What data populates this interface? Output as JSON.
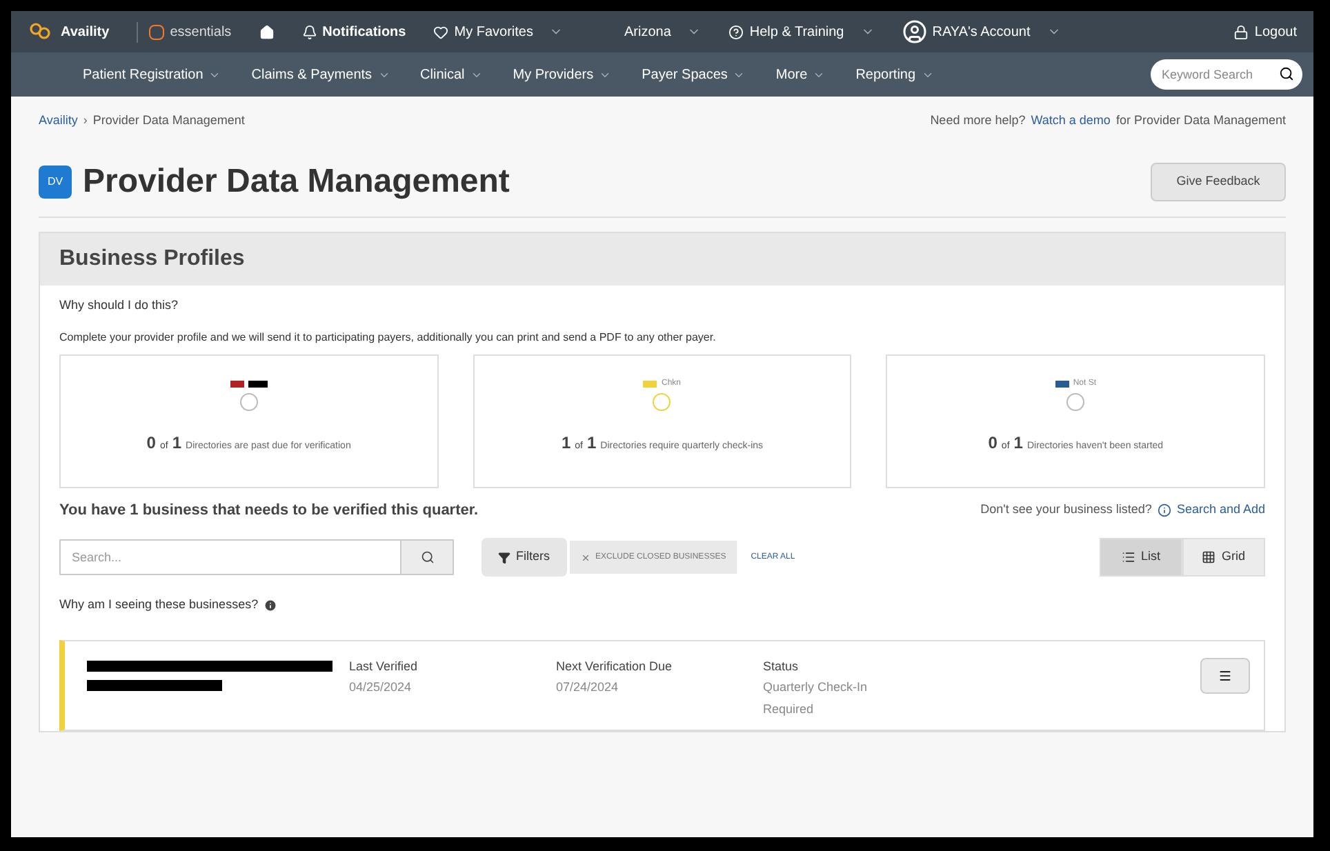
{
  "top_bar": {
    "brand": "Availity",
    "essentials": "essentials",
    "items": [
      {
        "kind": "notifications",
        "label": "Notifications"
      },
      {
        "kind": "favorites",
        "label": "My Favorites"
      },
      {
        "kind": "region",
        "label": "Arizona"
      },
      {
        "kind": "help",
        "label": "Help & Training"
      },
      {
        "kind": "account",
        "label": "RAYA's Account"
      },
      {
        "kind": "logout",
        "label": "Logout"
      }
    ]
  },
  "nav": {
    "items": [
      "Patient Registration",
      "Claims & Payments",
      "Clinical",
      "My Providers",
      "Payer Spaces",
      "More",
      "Reporting"
    ],
    "search": {
      "placeholder": "Keyword Search"
    }
  },
  "breadcrumb": [
    "Availity",
    "›",
    "Provider Data Management"
  ],
  "help": {
    "before": "Need more help?",
    "link": "Watch a demo",
    "after": "for Provider Data Management"
  },
  "page": {
    "badge": "DV",
    "title": "Provider Data Management",
    "feedback": "Give Feedback"
  },
  "panel": {
    "title": "Business Profiles",
    "question": "Why should I do this?",
    "intro": "Complete your provider profile and we will send it to participating payers, additionally you can print and send a PDF to any other payer.",
    "cards": [
      {
        "color": "#b22222",
        "done": false,
        "count": "0",
        "of": "of",
        "total": "1",
        "text": "Directories are past due for verification"
      },
      {
        "color": "#f2d23c",
        "legend": "Chkn",
        "done": true,
        "count": "1",
        "of": "of",
        "total": "1",
        "text": "Directories require quarterly check-ins"
      },
      {
        "color": "#2a5d8f",
        "legend": "Not St",
        "done": false,
        "count": "0",
        "of": "of",
        "total": "1",
        "text": "Directories haven't been started"
      }
    ],
    "summary": "You have 1 business that needs to be verified this quarter.",
    "not_listed": "Don't see your business listed?",
    "search_add": "Search and Add",
    "search": {
      "placeholder": "Search..."
    },
    "filters": "Filters",
    "chip": "EXCLUDE CLOSED BUSINESSES",
    "clear": "CLEAR ALL",
    "views": [
      {
        "label": "List",
        "selected": true
      },
      {
        "label": "Grid",
        "selected": false
      }
    ],
    "why": "Why am I seeing these businesses?",
    "row": {
      "color": "#f2d23c",
      "columns": [
        {
          "label": "Last Verified",
          "value": "04/25/2024"
        },
        {
          "label": "Next Verification Due",
          "value": "07/24/2024"
        },
        {
          "label": "Status",
          "value": "Quarterly Check-In Required"
        }
      ]
    }
  }
}
